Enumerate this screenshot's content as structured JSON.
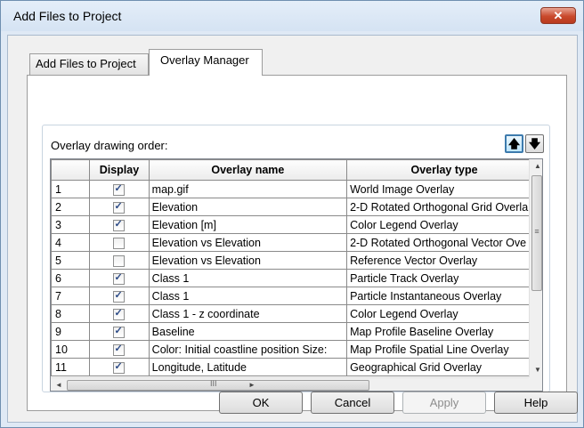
{
  "window": {
    "title": "Add Files to Project",
    "close_glyph": "✕"
  },
  "tabs": [
    {
      "label": "Add Files to Project"
    },
    {
      "label": "Overlay Manager"
    }
  ],
  "panel": {
    "order_label": "Overlay drawing order:",
    "up_glyph": "🡅",
    "down_glyph": "🡇"
  },
  "table": {
    "columns": [
      "",
      "Display",
      "Overlay name",
      "Overlay type"
    ],
    "rows": [
      {
        "n": "1",
        "display": true,
        "name": "map.gif",
        "type": "World Image Overlay"
      },
      {
        "n": "2",
        "display": true,
        "name": "Elevation",
        "type": "2-D Rotated Orthogonal Grid Overla"
      },
      {
        "n": "3",
        "display": true,
        "name": "Elevation [m]",
        "type": "Color Legend Overlay"
      },
      {
        "n": "4",
        "display": false,
        "name": "Elevation vs Elevation",
        "type": "2-D Rotated Orthogonal Vector Ove"
      },
      {
        "n": "5",
        "display": false,
        "name": "Elevation vs Elevation",
        "type": "Reference Vector Overlay"
      },
      {
        "n": "6",
        "display": true,
        "name": "Class 1",
        "type": "Particle Track Overlay"
      },
      {
        "n": "7",
        "display": true,
        "name": "Class 1",
        "type": "Particle Instantaneous Overlay"
      },
      {
        "n": "8",
        "display": true,
        "name": "Class 1 - z coordinate",
        "type": "Color Legend Overlay"
      },
      {
        "n": "9",
        "display": true,
        "name": "Baseline",
        "type": "Map Profile Baseline Overlay"
      },
      {
        "n": "10",
        "display": true,
        "name": "Color: Initial coastline position Size:",
        "type": "Map Profile Spatial Line Overlay"
      },
      {
        "n": "11",
        "display": true,
        "name": "Longitude, Latitude",
        "type": "Geographical Grid Overlay"
      }
    ]
  },
  "buttons": {
    "ok": "OK",
    "cancel": "Cancel",
    "apply": "Apply",
    "help": "Help"
  },
  "scrollbar": {
    "grip_v": "≡",
    "grip_h": "III",
    "up": "▲",
    "down": "▼",
    "left": "◄",
    "right": "►"
  }
}
